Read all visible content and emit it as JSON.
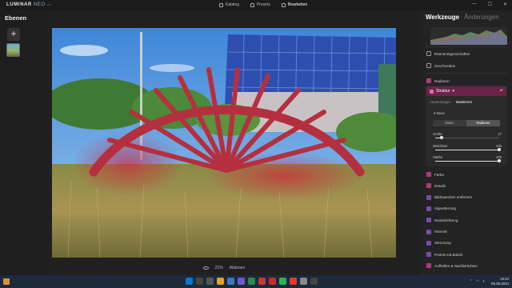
{
  "app": {
    "logo": "LUMINAR",
    "logo_suffix": "NEO"
  },
  "topnav": {
    "items": [
      {
        "label": "Katalog",
        "icon": "catalog-icon"
      },
      {
        "label": "Presets",
        "icon": "presets-icon"
      },
      {
        "label": "Bearbeiten",
        "icon": "edit-icon",
        "active": true
      }
    ]
  },
  "window_controls": {
    "minimize": "—",
    "maximize": "☐",
    "close": "✕"
  },
  "left_panel": {
    "title": "Ebenen",
    "add_label": "+"
  },
  "canvas_bar": {
    "zoom": "21%",
    "actions": "Aktionen"
  },
  "right_panel": {
    "tab_tools": "Werkzeuge",
    "tab_changes": "Änderungen",
    "layer_props": "Ebeneneigenschaften",
    "crop": "Zuschneiden",
    "erase": "Radieren",
    "structure": "Struktur",
    "subtab_adjust": "Anpassungen",
    "subtab_mask": "Maskieren",
    "new_label": "Neue",
    "seg_paint": "Malen",
    "seg_erase": "Radieren",
    "sliders": [
      {
        "label": "Größe",
        "value": "17",
        "fraction": 0.1
      },
      {
        "label": "Weichheit",
        "value": "100",
        "fraction": 1.0
      },
      {
        "label": "Stärke",
        "value": "100",
        "fraction": 1.0
      }
    ],
    "tools": [
      {
        "label": "Farbe",
        "icon": "color-icon"
      },
      {
        "label": "Details",
        "icon": "details-icon"
      },
      {
        "label": "Bildrauschen entfernen",
        "icon": "denoise-icon"
      },
      {
        "label": "Vignettierung",
        "icon": "vignette-icon"
      },
      {
        "label": "Neubelichtung",
        "icon": "relight-icon"
      },
      {
        "label": "Himmel",
        "icon": "sky-icon"
      },
      {
        "label": "Stimmung",
        "icon": "mood-icon"
      },
      {
        "label": "Porträt mit Bokeh",
        "icon": "bokeh-icon"
      },
      {
        "label": "Aufhellen & Nachbelichten",
        "icon": "dodge-burn-icon"
      }
    ]
  },
  "taskbar": {
    "time": "18:24",
    "date": "06.08.2024",
    "app_colors": [
      "#0078d4",
      "#444444",
      "#555555",
      "#e8a020",
      "#3a78c8",
      "#6a5acd",
      "#2a8a4a",
      "#cc3333",
      "#d02828",
      "#1db954",
      "#ee3333",
      "#888888",
      "#444444"
    ]
  },
  "colors": {
    "accent": "#6a2448",
    "mask": "#c8203a"
  }
}
